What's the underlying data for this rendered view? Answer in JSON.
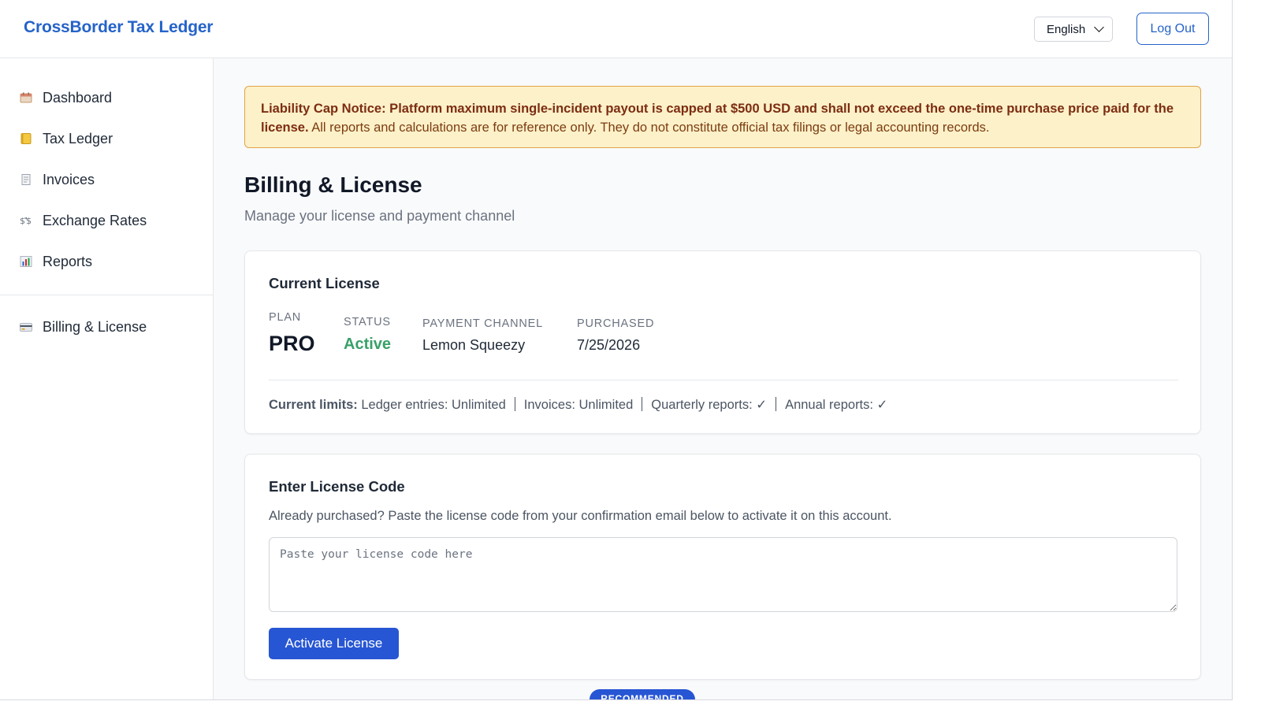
{
  "header": {
    "brand": "CrossBorder Tax Ledger",
    "language": "English",
    "logout_label": "Log Out"
  },
  "sidebar": {
    "items": [
      {
        "label": "Dashboard",
        "icon": "calendar-icon"
      },
      {
        "label": "Tax Ledger",
        "icon": "ledger-book-icon"
      },
      {
        "label": "Invoices",
        "icon": "receipt-icon"
      },
      {
        "label": "Exchange Rates",
        "icon": "currency-exchange-icon"
      },
      {
        "label": "Reports",
        "icon": "bar-chart-icon"
      }
    ],
    "secondary": [
      {
        "label": "Billing & License",
        "icon": "credit-card-icon",
        "active": true
      }
    ]
  },
  "notice": {
    "bold_text": "Liability Cap Notice: Platform maximum single-incident payout is capped at $500 USD and shall not exceed the one-time purchase price paid for the license.",
    "text": " All reports and calculations are for reference only. They do not constitute official tax filings or legal accounting records."
  },
  "page": {
    "title": "Billing & License",
    "subtitle": "Manage your license and payment channel"
  },
  "current_license": {
    "title": "Current License",
    "plan_label": "PLAN",
    "plan_value": "PRO",
    "status_label": "STATUS",
    "status_value": "Active",
    "payment_label": "PAYMENT CHANNEL",
    "payment_value": "Lemon Squeezy",
    "purchased_label": "PURCHASED",
    "purchased_value": "7/25/2026",
    "limits_label": "Current limits:",
    "limits": [
      "Ledger entries: Unlimited",
      "Invoices: Unlimited",
      "Quarterly reports: ✓",
      "Annual reports: ✓"
    ]
  },
  "license_code": {
    "title": "Enter License Code",
    "help": "Already purchased? Paste the license code from your confirmation email below to activate it on this account.",
    "placeholder": "Paste your license code here",
    "value": "",
    "button_label": "Activate License"
  },
  "badge": {
    "label": "RECOMMENDED"
  },
  "colors": {
    "brand": "#2563c9",
    "primary_button": "#2756d4",
    "status_active": "#38a169",
    "notice_bg": "#fdf1c9",
    "notice_border": "#e0a447",
    "notice_text": "#7c2d12"
  }
}
